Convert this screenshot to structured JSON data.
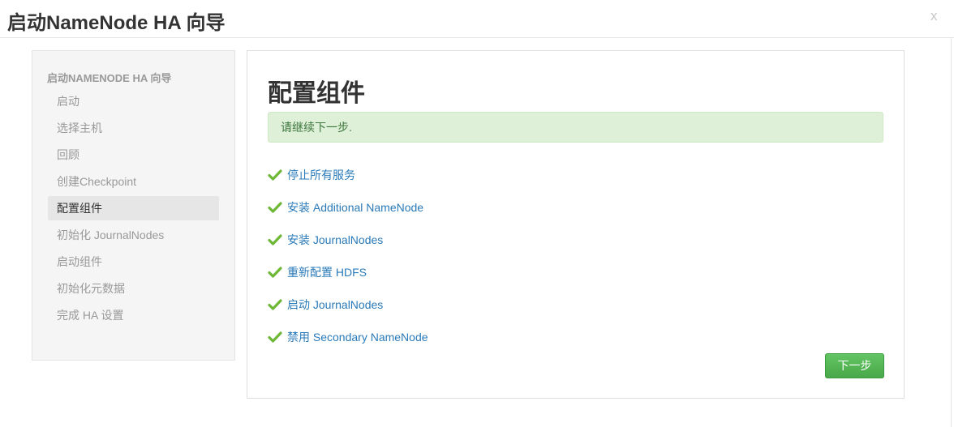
{
  "modal": {
    "title": "启动NameNode HA 向导",
    "close_label": "x"
  },
  "sidebar": {
    "header": "启动NAMENODE HA 向导",
    "items": [
      {
        "label": "启动",
        "active": false
      },
      {
        "label": "选择主机",
        "active": false
      },
      {
        "label": "回顾",
        "active": false
      },
      {
        "label": "创建Checkpoint",
        "active": false
      },
      {
        "label": "配置组件",
        "active": true
      },
      {
        "label": "初始化 JournalNodes",
        "active": false
      },
      {
        "label": "启动组件",
        "active": false
      },
      {
        "label": "初始化元数据",
        "active": false
      },
      {
        "label": "完成 HA 设置",
        "active": false
      }
    ]
  },
  "main": {
    "title": "配置组件",
    "alert": "请继续下一步.",
    "tasks": [
      {
        "label": "停止所有服务",
        "icon": "check-icon"
      },
      {
        "label": "安装 Additional NameNode",
        "icon": "check-icon"
      },
      {
        "label": "安装 JournalNodes",
        "icon": "check-icon"
      },
      {
        "label": "重新配置 HDFS",
        "icon": "check-icon"
      },
      {
        "label": "启动 JournalNodes",
        "icon": "check-icon"
      },
      {
        "label": "禁用 Secondary NameNode",
        "icon": "check-icon"
      }
    ],
    "next_label": "下一步"
  },
  "colors": {
    "success": "#5cb85c",
    "link": "#2a7ab8",
    "alert_bg": "#dff0d8",
    "check": "#6fb737"
  }
}
